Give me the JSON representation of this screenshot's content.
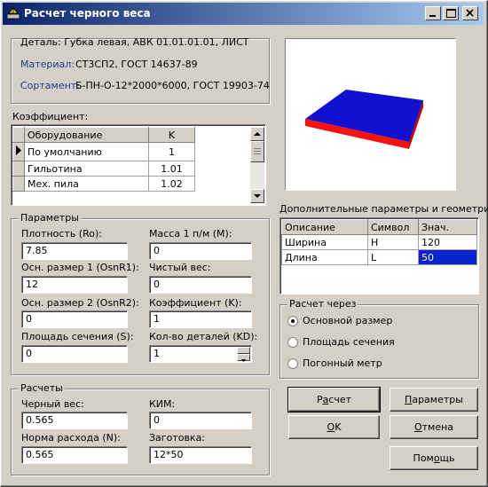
{
  "window": {
    "title": "Расчет черного веса"
  },
  "header": {
    "detail": "Деталь: Губка левая, АВК 01.01.01.01, ЛИСТ",
    "material_label": "Материал:",
    "material_value": "СТ3СП2, ГОСТ 14637-89",
    "sortament_label": "Сортамент:",
    "sortament_value": "Б-ПН-О-12*2000*6000, ГОСТ 19903-74"
  },
  "coef": {
    "title": "Коэффициент:",
    "columns": [
      "Оборудование",
      "K"
    ],
    "rows": [
      {
        "name": "По умолчанию",
        "k": "1"
      },
      {
        "name": "Гильотина",
        "k": "1.01"
      },
      {
        "name": "Мех. пила",
        "k": "1.02"
      }
    ]
  },
  "params": {
    "title": "Параметры",
    "density_label": "Плотность (Ro):",
    "density": "7.85",
    "mass_label": "Масса 1 п/м (M):",
    "mass": "0",
    "osn1_label": "Осн. размер 1 (OsnR1):",
    "osn1": "12",
    "clean_label": "Чистый вес:",
    "clean": "0",
    "osn2_label": "Осн. размер 2 (OsnR2):",
    "osn2": "0",
    "k_label": "Коэффициент (K):",
    "k": "1",
    "area_label": "Площадь сечения (S):",
    "area": "0",
    "kd_label": "Кол-во деталей (KD):",
    "kd": "1"
  },
  "results": {
    "title": "Расчеты",
    "black_label": "Черный вес:",
    "black": "0.565",
    "kim_label": "КИМ:",
    "kim": "0",
    "norm_label": "Норма расхода (N):",
    "norm": "0.565",
    "blank_label": "Заготовка:",
    "blank": "12*50"
  },
  "extra": {
    "title": "Дополнительные параметры и геометрия:",
    "columns": [
      "Описание",
      "Символ",
      "Знач."
    ],
    "rows": [
      {
        "desc": "Ширина",
        "sym": "H",
        "val": "120"
      },
      {
        "desc": "Длина",
        "sym": "L",
        "val": "50"
      }
    ]
  },
  "calc_via": {
    "title": "Расчет через",
    "options": [
      "Основной размер",
      "Площадь сечения",
      "Погонный метр"
    ],
    "selected": 0
  },
  "buttons": {
    "calc_pre": "Р",
    "calc_u": "а",
    "calc_post": "счет",
    "params_pre": "",
    "params_u": "П",
    "params_post": "араметры",
    "ok_pre": "",
    "ok_u": "O",
    "ok_post": "K",
    "cancel_pre": "",
    "cancel_u": "О",
    "cancel_post": "тмена",
    "help_pre": "Пом",
    "help_u": "о",
    "help_post": "щь"
  },
  "colors": {
    "titlebar": "#0a246a",
    "selected_cell": "#0a24cc",
    "slab_top": "#1010d0",
    "slab_edge": "#ff1010"
  }
}
